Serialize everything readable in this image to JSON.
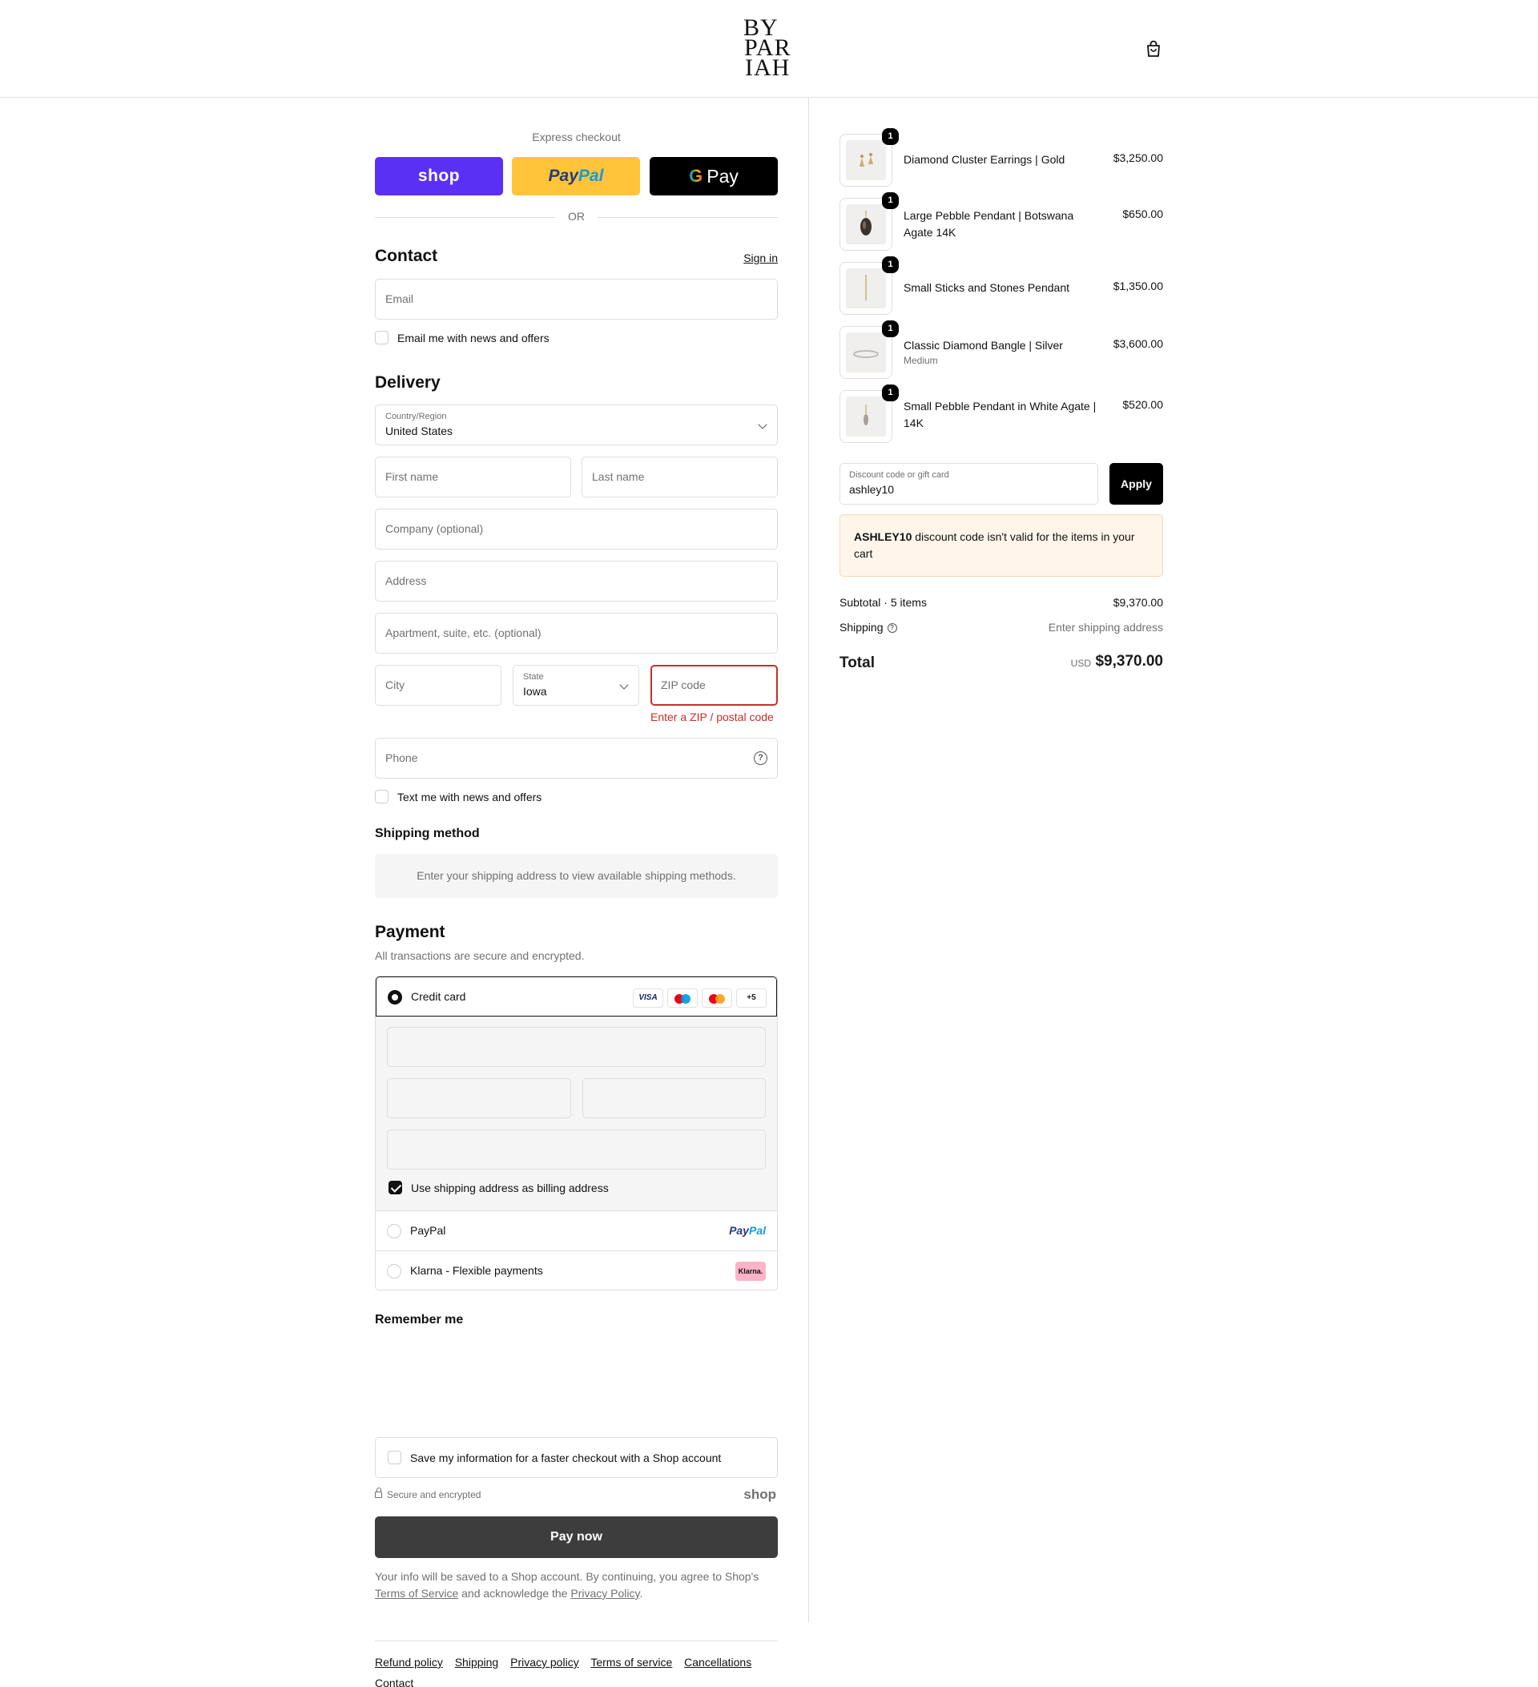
{
  "header": {
    "logo_lines": [
      "BY",
      "PAR",
      "IAH"
    ],
    "cart_icon": "shopping-bag-icon"
  },
  "express": {
    "title": "Express checkout",
    "shop_label": "shop",
    "paypal_label_1": "Pay",
    "paypal_label_2": "Pal",
    "gpay_g": "G",
    "gpay_label": "Pay",
    "or": "OR"
  },
  "contact": {
    "title": "Contact",
    "sign_in": "Sign in",
    "email_placeholder": "Email",
    "news_label": "Email me with news and offers"
  },
  "delivery": {
    "title": "Delivery",
    "country_label": "Country/Region",
    "country_value": "United States",
    "first_name": "First name",
    "last_name": "Last name",
    "company": "Company (optional)",
    "address": "Address",
    "apartment": "Apartment, suite, etc. (optional)",
    "city": "City",
    "state_label": "State",
    "state_value": "Iowa",
    "zip": "ZIP code",
    "zip_error": "Enter a ZIP / postal code",
    "phone": "Phone",
    "text_label": "Text me with news and offers"
  },
  "shipping_method": {
    "title": "Shipping method",
    "message": "Enter your shipping address to view available shipping methods."
  },
  "payment": {
    "title": "Payment",
    "subtitle": "All transactions are secure and encrypted.",
    "credit_card": "Credit card",
    "card_visa": "VISA",
    "card_more": "+5",
    "billing_label": "Use shipping address as billing address",
    "paypal": "PayPal",
    "paypal_logo_1": "Pay",
    "paypal_logo_2": "Pal",
    "klarna": "Klarna - Flexible payments",
    "klarna_badge": "Klarna."
  },
  "remember": {
    "title": "Remember me",
    "save_label": "Save my information for a faster checkout with a Shop account",
    "secure": "Secure and encrypted",
    "shop_mark": "shop"
  },
  "pay_now": "Pay now",
  "legal": {
    "line1": "Your info will be saved to a Shop account. By continuing, you agree to Shop's",
    "terms": "Terms of Service",
    "and": "and acknowledge the",
    "privacy": "Privacy Policy",
    "end": "."
  },
  "footer_links": [
    "Refund policy",
    "Shipping",
    "Privacy policy",
    "Terms of service",
    "Cancellations",
    "Contact"
  ],
  "cart": {
    "items": [
      {
        "name": "Diamond Cluster Earrings | Gold",
        "variant": "",
        "price": "$3,250.00",
        "qty": "1"
      },
      {
        "name": "Large Pebble Pendant | Botswana Agate 14K",
        "variant": "",
        "price": "$650.00",
        "qty": "1"
      },
      {
        "name": "Small Sticks and Stones Pendant",
        "variant": "",
        "price": "$1,350.00",
        "qty": "1"
      },
      {
        "name": "Classic Diamond Bangle | Silver",
        "variant": "Medium",
        "price": "$3,600.00",
        "qty": "1"
      },
      {
        "name": "Small Pebble Pendant in White Agate | 14K",
        "variant": "",
        "price": "$520.00",
        "qty": "1"
      }
    ],
    "discount_label": "Discount code or gift card",
    "discount_value": "ashley10",
    "apply": "Apply",
    "warning_code": "ASHLEY10",
    "warning_text": " discount code isn't valid for the items in your cart",
    "subtotal_label": "Subtotal · 5 items",
    "subtotal_value": "$9,370.00",
    "shipping_label": "Shipping",
    "shipping_value": "Enter shipping address",
    "total_label": "Total",
    "total_currency": "USD",
    "total_value": "$9,370.00"
  },
  "colors": {
    "shop_purple": "#5a31f4",
    "paypal_yellow": "#ffc439",
    "error_red": "#c4302b",
    "pay_button": "#3d3d3d",
    "warning_bg": "#fff5ea"
  }
}
